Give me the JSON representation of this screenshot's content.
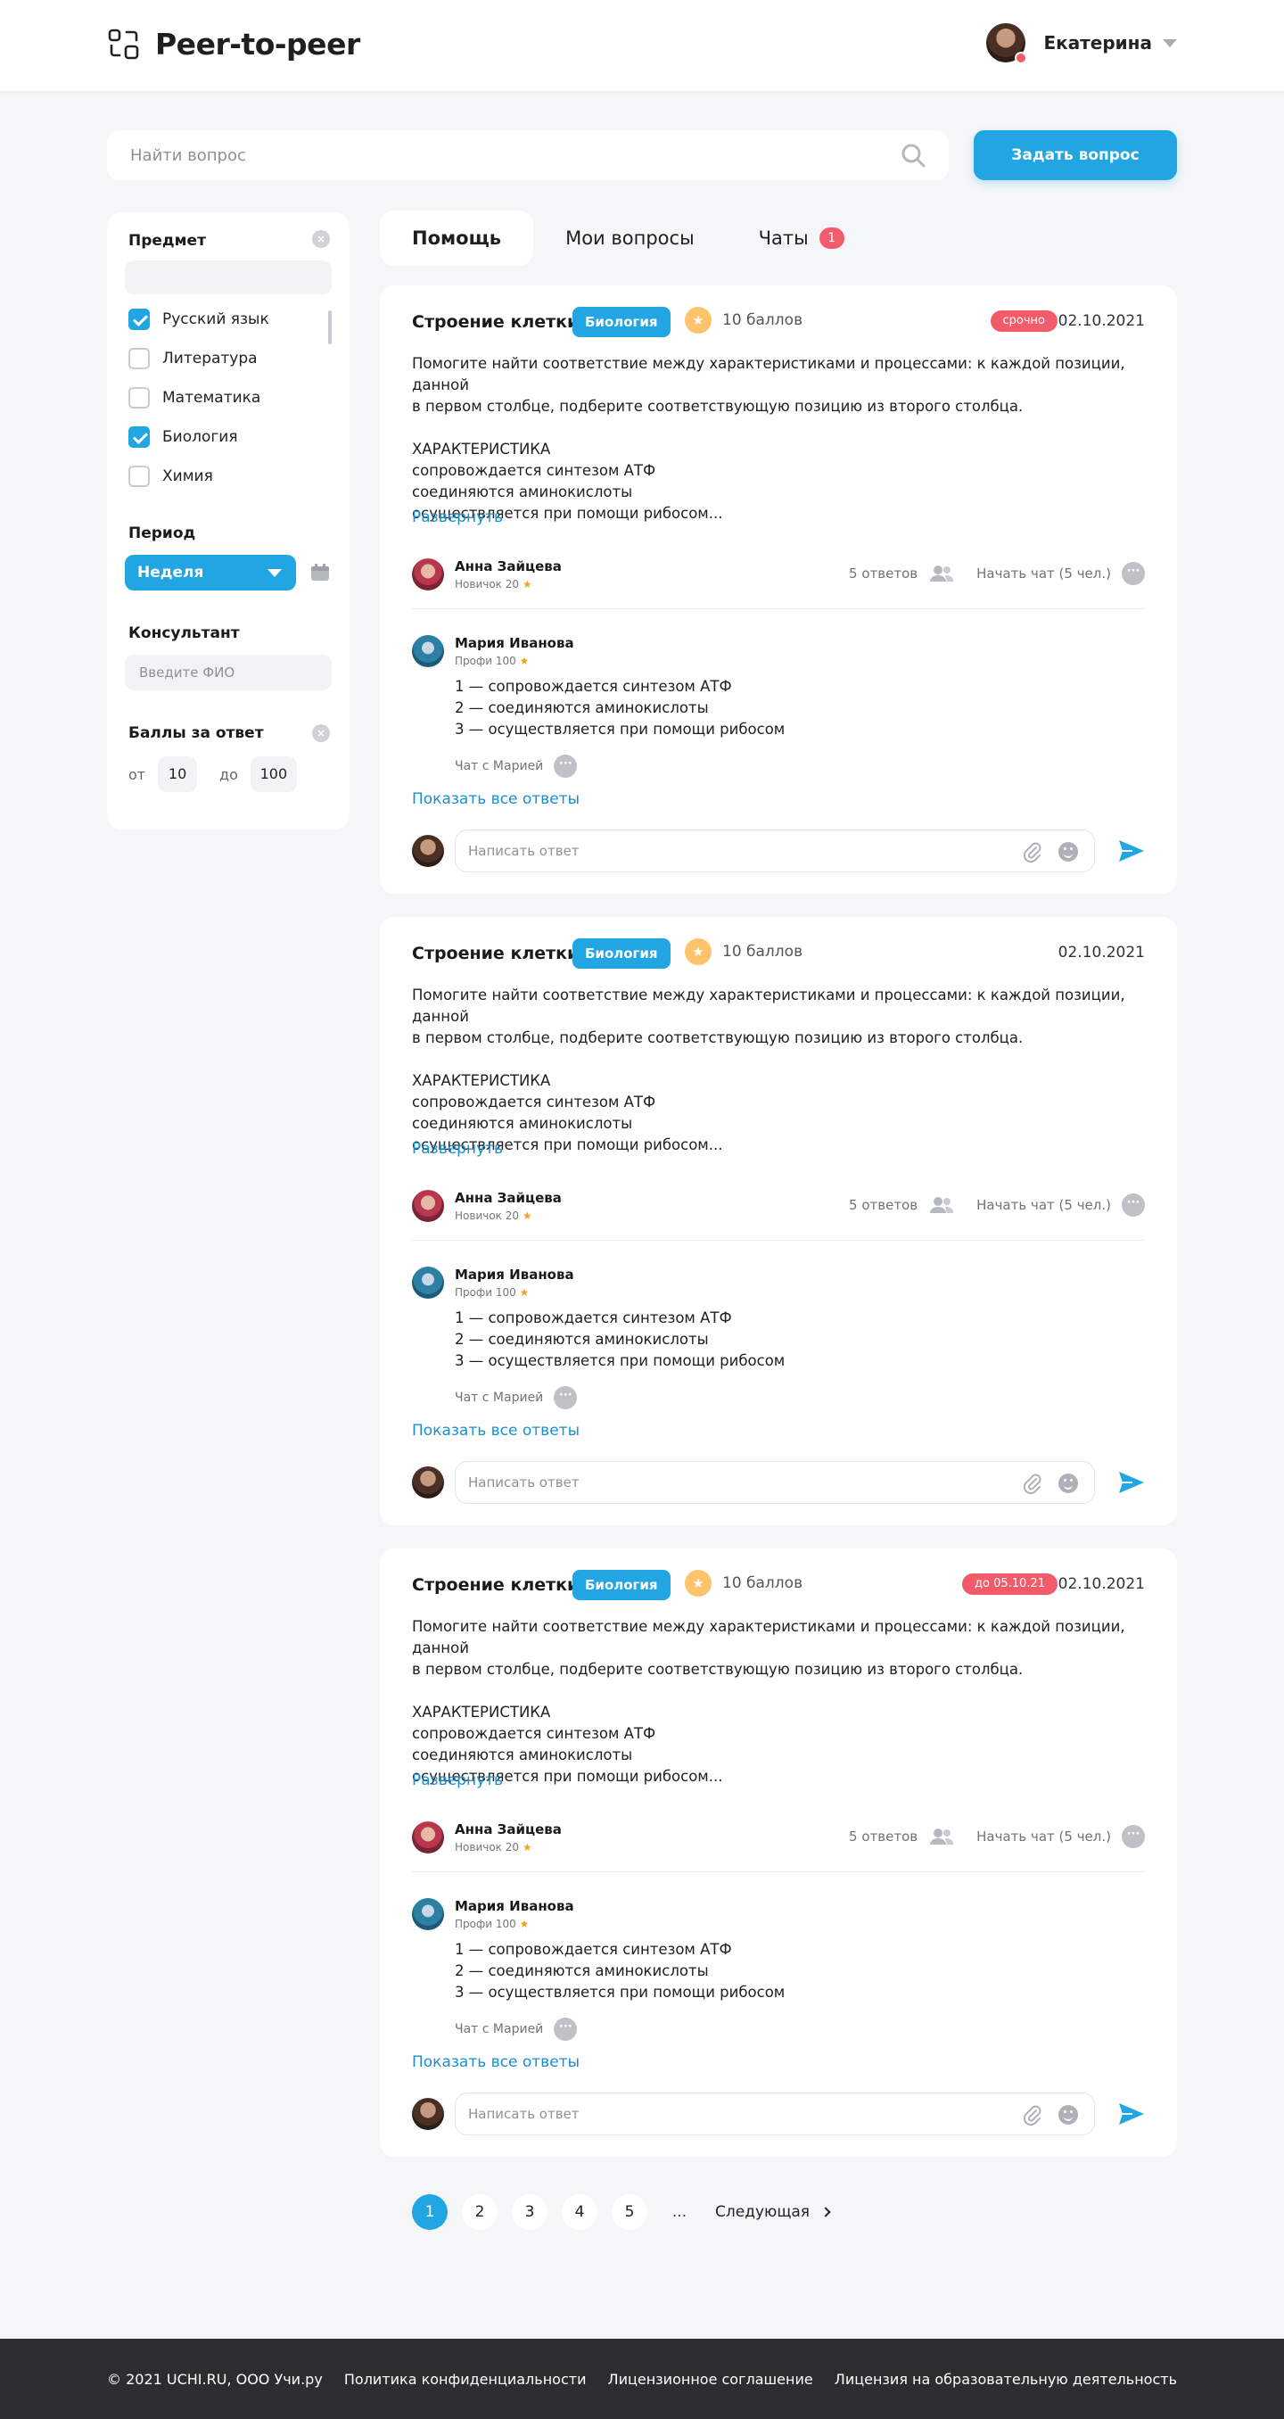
{
  "header": {
    "app_title": "Peer-to-peer",
    "user_name": "Екатерина"
  },
  "search": {
    "placeholder": "Найти вопрос"
  },
  "ask_button": "Задать вопрос",
  "filters": {
    "subject_title": "Предмет",
    "subjects": [
      {
        "label": "Русский язык",
        "checked": true
      },
      {
        "label": "Литература",
        "checked": false
      },
      {
        "label": "Математика",
        "checked": false
      },
      {
        "label": "Биология",
        "checked": true
      },
      {
        "label": "Химия",
        "checked": false
      }
    ],
    "period_title": "Период",
    "period_value": "Неделя",
    "consultant_title": "Консультант",
    "consultant_placeholder": "Введите ФИО",
    "points_title": "Баллы за ответ",
    "from_label": "от",
    "from_value": "10",
    "to_label": "до",
    "to_value": "100"
  },
  "tabs": [
    {
      "label": "Помощь",
      "active": true
    },
    {
      "label": "Мои вопросы",
      "active": false
    },
    {
      "label": "Чаты",
      "active": false,
      "badge": "1"
    }
  ],
  "questions": [
    {
      "title": "Строение клетки",
      "subject": "Биология",
      "points": "10 баллов",
      "badge": "срочно",
      "date": "02.10.2021",
      "body": "Помогите найти соответствие между характеристиками и процессами: к каждой позиции, данной\nв первом столбце, подберите соответствующую позицию из второго столбца.\n\nХАРАКТЕРИСТИКА\nсопровождается синтезом АТФ\nсоединяются аминокислоты\nосуществляется при помощи рибосом...",
      "expand": "Развернуть",
      "author": {
        "name": "Анна Зайцева",
        "rank": "Новичок 20"
      },
      "answers_count": "5 ответов",
      "start_chat": "Начать чат (5 чел.)",
      "answer": {
        "name": "Мария Иванова",
        "rank": "Профи 100",
        "lines": [
          "1 — сопровождается синтезом АТФ",
          "2 — соединяются аминокислоты",
          "3 — осуществляется при помощи рибосом"
        ],
        "chat_with": "Чат с Марией"
      },
      "show_all": "Показать все ответы",
      "reply_placeholder": "Написать ответ"
    },
    {
      "title": "Строение клетки",
      "subject": "Биология",
      "points": "10 баллов",
      "badge": "",
      "date": "02.10.2021",
      "body": "Помогите найти соответствие между характеристиками и процессами: к каждой позиции, данной\nв первом столбце, подберите соответствующую позицию из второго столбца.\n\nХАРАКТЕРИСТИКА\nсопровождается синтезом АТФ\nсоединяются аминокислоты\nосуществляется при помощи рибосом...",
      "expand": "Развернуть",
      "author": {
        "name": "Анна Зайцева",
        "rank": "Новичок 20"
      },
      "answers_count": "5 ответов",
      "start_chat": "Начать чат (5 чел.)",
      "answer": {
        "name": "Мария Иванова",
        "rank": "Профи 100",
        "lines": [
          "1 — сопровождается синтезом АТФ",
          "2 — соединяются аминокислоты",
          "3 — осуществляется при помощи рибосом"
        ],
        "chat_with": "Чат с Марией"
      },
      "show_all": "Показать все ответы",
      "reply_placeholder": "Написать ответ"
    },
    {
      "title": "Строение клетки",
      "subject": "Биология",
      "points": "10 баллов",
      "badge": "до 05.10.21",
      "date": "02.10.2021",
      "body": "Помогите найти соответствие между характеристиками и процессами: к каждой позиции, данной\nв первом столбце, подберите соответствующую позицию из второго столбца.\n\nХАРАКТЕРИСТИКА\nсопровождается синтезом АТФ\nсоединяются аминокислоты\nосуществляется при помощи рибосом...",
      "expand": "Развернуть",
      "author": {
        "name": "Анна Зайцева",
        "rank": "Новичок 20"
      },
      "answers_count": "5 ответов",
      "start_chat": "Начать чат (5 чел.)",
      "answer": {
        "name": "Мария Иванова",
        "rank": "Профи 100",
        "lines": [
          "1 — сопровождается синтезом АТФ",
          "2 — соединяются аминокислоты",
          "3 — осуществляется при помощи рибосом"
        ],
        "chat_with": "Чат с Марией"
      },
      "show_all": "Показать все ответы",
      "reply_placeholder": "Написать ответ"
    }
  ],
  "pagination": {
    "pages": [
      "1",
      "2",
      "3",
      "4",
      "5"
    ],
    "current": "1",
    "ellipsis": "...",
    "next": "Следующая"
  },
  "footer": {
    "copyright": "© 2021 UCHI.RU, ООО Учи.ру",
    "links": [
      "Политика конфиденциальности",
      "Лицензионное соглашение",
      "Лицензия на образовательную деятельность"
    ]
  },
  "colors": {
    "accent": "#22A6E3",
    "badge_red": "#F25C6A",
    "star": "#FFC46B",
    "background": "#F5F6F8",
    "footer": "#2C2D2F"
  }
}
